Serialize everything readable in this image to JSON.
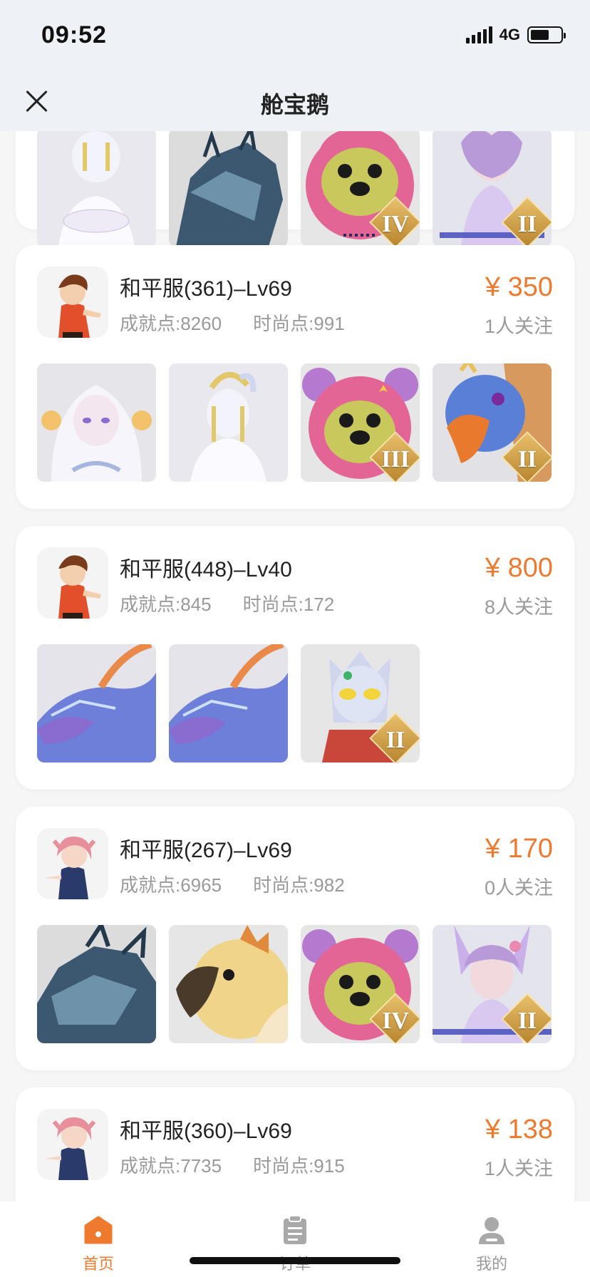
{
  "status": {
    "time": "09:52",
    "network": "4G",
    "battery_level": 0.62
  },
  "nav": {
    "title": "舱宝鹅",
    "close_icon": "close-icon"
  },
  "listings": [
    {
      "partial": true,
      "thumbnails": [
        {
          "desc": "white-fairy-outfit",
          "rank": ""
        },
        {
          "desc": "dark-dragon",
          "rank": ""
        },
        {
          "desc": "pink-bear-hat",
          "rank": "IV"
        },
        {
          "desc": "violet-fox-girl",
          "rank": "II"
        }
      ]
    },
    {
      "server": "和平服(361)–Lv69",
      "achievement": "成就点:8260",
      "fashion": "时尚点:991",
      "price": "¥ 350",
      "followers": "1人关注",
      "avatar": "boy-avatar",
      "thumbnails": [
        {
          "desc": "white-fairy-girl",
          "rank": ""
        },
        {
          "desc": "white-fairy-outfit",
          "rank": ""
        },
        {
          "desc": "pink-bear-hat",
          "rank": "III"
        },
        {
          "desc": "blue-eagle",
          "rank": "II"
        }
      ]
    },
    {
      "server": "和平服(448)–Lv40",
      "achievement": "成就点:845",
      "fashion": "时尚点:172",
      "price": "¥ 800",
      "followers": "8人关注",
      "avatar": "boy-avatar",
      "thumbnails": [
        {
          "desc": "blue-dragon",
          "rank": ""
        },
        {
          "desc": "blue-dragon",
          "rank": ""
        },
        {
          "desc": "silver-hero-mask",
          "rank": "II"
        }
      ]
    },
    {
      "server": "和平服(267)–Lv69",
      "achievement": "成就点:6965",
      "fashion": "时尚点:982",
      "price": "¥ 170",
      "followers": "0人关注",
      "avatar": "girl-avatar",
      "thumbnails": [
        {
          "desc": "dark-dragon",
          "rank": ""
        },
        {
          "desc": "golden-parrot",
          "rank": ""
        },
        {
          "desc": "pink-bear-hat",
          "rank": "IV"
        },
        {
          "desc": "violet-fox-girl",
          "rank": "II"
        }
      ]
    },
    {
      "server": "和平服(360)–Lv69",
      "achievement": "成就点:7735",
      "fashion": "时尚点:915",
      "price": "¥ 138",
      "followers": "1人关注",
      "avatar": "girl-avatar",
      "thumbnails": []
    }
  ],
  "tabs": [
    {
      "label": "首页",
      "icon": "home-icon",
      "active": true
    },
    {
      "label": "订单",
      "icon": "order-icon",
      "active": false
    },
    {
      "label": "我的",
      "icon": "profile-icon",
      "active": false
    }
  ],
  "colors": {
    "accent": "#ee7a2f",
    "header_bg": "#eef1f5",
    "page_bg": "#f6f6f6",
    "card_bg": "#ffffff",
    "muted_text": "#9a9a9a"
  }
}
